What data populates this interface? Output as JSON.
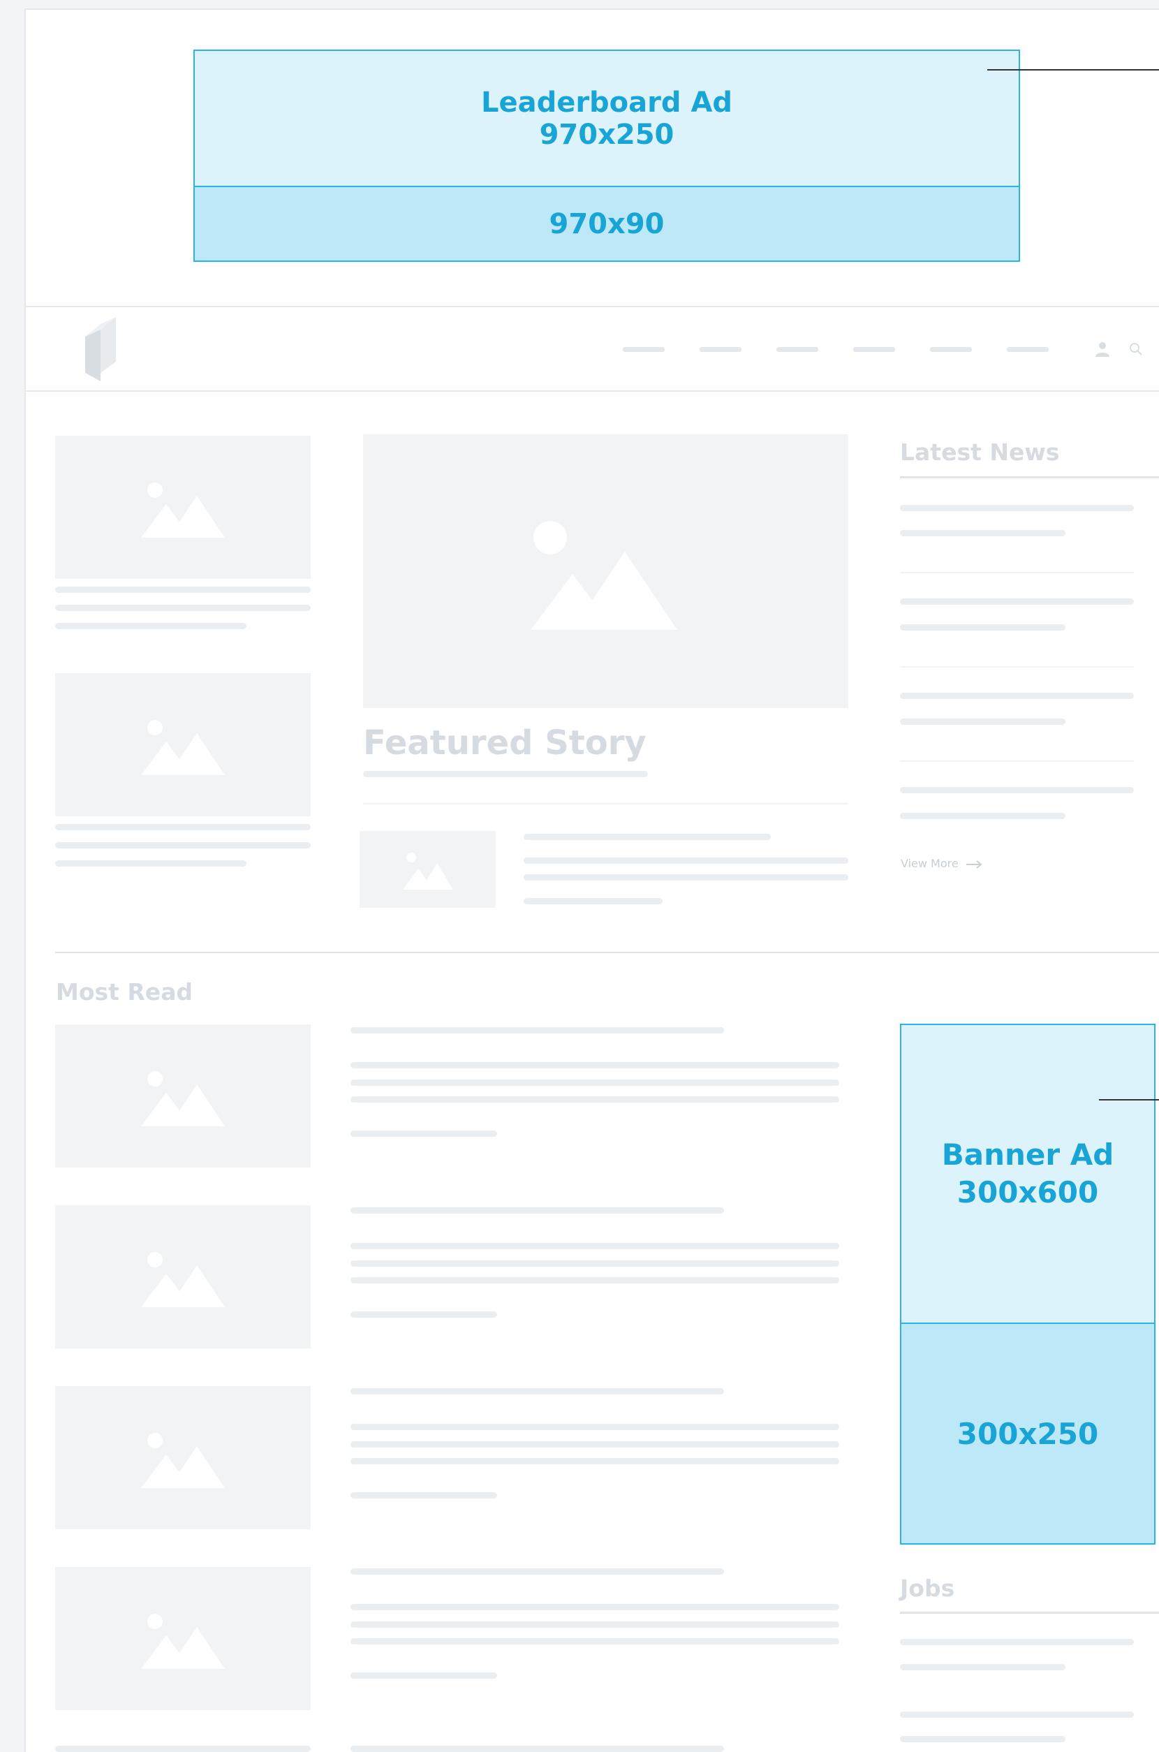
{
  "ads": {
    "leaderboard": {
      "title": "Leaderboard Ad",
      "size_primary": "970x250",
      "size_secondary": "970x90"
    },
    "banner": {
      "title": "Banner Ad",
      "size_primary": "300x600",
      "size_secondary": "300x250"
    }
  },
  "sections": {
    "featured_title": "Featured Story",
    "latest_news_title": "Latest News",
    "view_more_label": "View More",
    "most_read_title": "Most Read",
    "jobs_title": "Jobs"
  },
  "colors": {
    "ad_accent": "#2bb2e6",
    "ad_text": "#19a4d6",
    "placeholder": "#f1f3f5"
  },
  "icons": {
    "logo": "logo-icon",
    "user": "user-icon",
    "search": "search-icon",
    "image": "image-placeholder-icon",
    "arrow": "arrow-right-icon"
  }
}
